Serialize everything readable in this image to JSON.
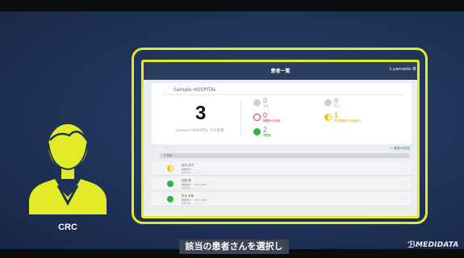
{
  "role": {
    "label": "CRC"
  },
  "app": {
    "title": "患者一覧",
    "user": "t.yamada",
    "settings_icon": "gear-icon"
  },
  "summary": {
    "hospital_name": "Sample HOSPITAL",
    "total_count": "3",
    "total_caption": "Sample HOSPITAL での患者",
    "stats": [
      {
        "count": "0",
        "label": "予定",
        "color": "#c8c8c8",
        "icon": "gray-dot-icon"
      },
      {
        "count": "0",
        "label": "完了",
        "color": "#c8c8c8",
        "icon": "gray-check-icon"
      },
      {
        "count": "0",
        "label": "期間外の記録",
        "color": "#e0196e",
        "icon": "pink-dots-icon"
      },
      {
        "count": "1",
        "label": "許容範囲内の記録あり",
        "color": "#f0c800",
        "icon": "yellow-half-icon"
      },
      {
        "count": "2",
        "label": "問題無",
        "color": "#2bb34a",
        "icon": "green-check-icon"
      }
    ]
  },
  "list": {
    "add_label": "+ 患者の追加",
    "search_placeholder": "検索",
    "rows": [
      {
        "name": "田中 花子",
        "line1": "被験者ID : ---",
        "line2": "最終記録 : ----/--/-- --:--",
        "status_color": "#f0c800",
        "icon": "yellow-half-icon"
      },
      {
        "name": "佐藤 健",
        "line1": "被験者ID : 1001-0001",
        "line2": "最終記録 : ----/--/-- --:--",
        "status_color": "#2bb34a",
        "icon": "green-check-icon"
      },
      {
        "name": "鈴木 太郎",
        "line1": "被験者ID : 1001-0002",
        "line2": "最終記録 : ----/--/-- --:--",
        "status_color": "#2bb34a",
        "icon": "green-check-icon"
      }
    ]
  },
  "caption": "該当の患者さんを選択し",
  "brand": {
    "name": "MEDIDATA",
    "accent": "#e3ea27"
  }
}
